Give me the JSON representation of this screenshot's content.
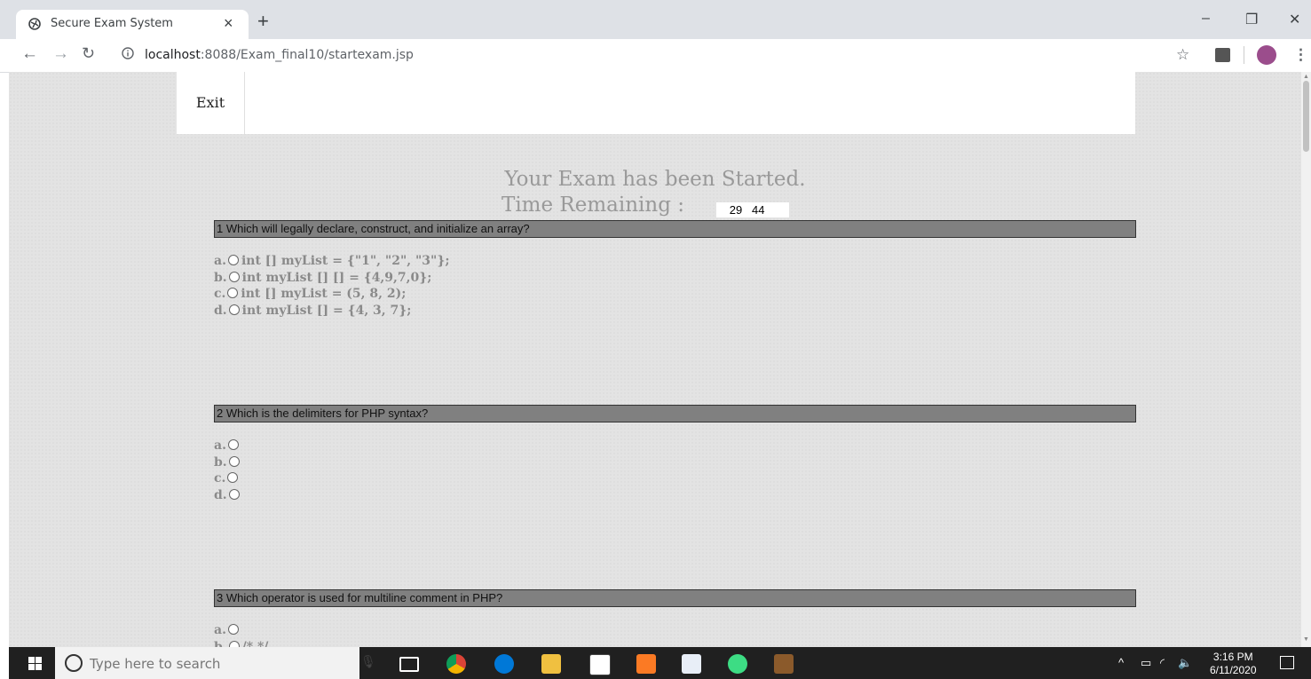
{
  "browser": {
    "tab_title": "Secure Exam System",
    "tab_close": "×",
    "new_tab": "+",
    "url_host": "localhost",
    "url_path": ":8088/Exam_final10/startexam.jsp",
    "controls": {
      "minimize": "–",
      "restore": "❐",
      "close": "✕"
    },
    "icons": [
      "back-icon",
      "forward-icon",
      "reload-icon",
      "info-icon",
      "bookmark-star-icon",
      "extension-icon",
      "profile-avatar",
      "menu-icon"
    ]
  },
  "page": {
    "exit_label": "Exit",
    "heading": "Your Exam has been Started.",
    "time_label": "Time Remaining :",
    "timer_minutes": "29",
    "timer_seconds": "44",
    "questions": [
      {
        "text": "1 Which will legally declare, construct, and initialize an array?",
        "options": [
          {
            "letter": "a.",
            "text": "int [] myList = {\"1\", \"2\", \"3\"};"
          },
          {
            "letter": "b.",
            "text": "int myList [] [] = {4,9,7,0};"
          },
          {
            "letter": "c.",
            "text": "int [] myList = (5, 8, 2);"
          },
          {
            "letter": "d.",
            "text": "int myList [] = {4, 3, 7};"
          }
        ]
      },
      {
        "text": "2 Which is the delimiters for PHP syntax?",
        "options": [
          {
            "letter": "a.",
            "text": ""
          },
          {
            "letter": "b.",
            "text": ""
          },
          {
            "letter": "c.",
            "text": ""
          },
          {
            "letter": "d.",
            "text": ""
          }
        ]
      },
      {
        "text": "3 Which operator is used for multiline comment in PHP?",
        "options": [
          {
            "letter": "a.",
            "text": ""
          },
          {
            "letter": "b.",
            "text": "/* */"
          }
        ]
      }
    ]
  },
  "taskbar": {
    "search_placeholder": "Type here to search",
    "time": "3:16 PM",
    "date": "6/11/2020",
    "tray_caret": "^"
  }
}
